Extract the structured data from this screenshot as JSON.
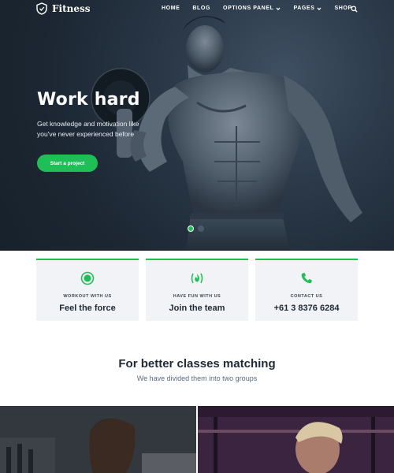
{
  "nav": {
    "logo_text": "Fitness",
    "logo_icon": "shield-icon",
    "items": [
      {
        "label": "HOME",
        "dropdown": false
      },
      {
        "label": "BLOG",
        "dropdown": false
      },
      {
        "label": "OPTIONS PANEL",
        "dropdown": true
      },
      {
        "label": "PAGES",
        "dropdown": true
      },
      {
        "label": "SHOP",
        "dropdown": false
      }
    ],
    "search_icon": "search-icon"
  },
  "hero": {
    "title": "Work hard",
    "subtitle": "Get knowledge and motivation like you've never experienced before",
    "cta_label": "Start a project",
    "slides": 2,
    "active_slide": 1
  },
  "cards": [
    {
      "icon": "target-icon",
      "label": "WORKOUT WITH US",
      "title": "Feel the force"
    },
    {
      "icon": "flame-icon",
      "label": "HAVE FUN WITH US",
      "title": "Join the team"
    },
    {
      "icon": "phone-icon",
      "label": "CONTACT US",
      "title": "+61 3 8376 6284"
    }
  ],
  "section": {
    "title": "For better classes matching",
    "subtitle": "We have divided them into two groups"
  },
  "colors": {
    "accent": "#1fbf58",
    "hero_bg": "#1c2733",
    "card_bg": "#f1f3f6",
    "heading": "#1f2a37"
  }
}
